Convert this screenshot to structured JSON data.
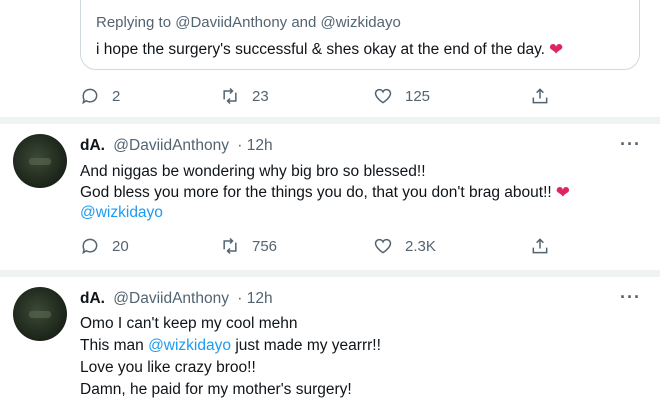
{
  "quoted_reply": {
    "header_partial": "@_ _ _ _ _ _ _ _ _",
    "replying_prefix": "Replying to",
    "replying_to": "@DaviidAnthony",
    "and": "and",
    "replying_to_2": "@wizkidayo",
    "text": "i hope the surgery's successful & shes okay at the end of the day.",
    "emoji": "❤"
  },
  "quoted_actions": {
    "replies": "2",
    "retweets": "23",
    "likes": "125"
  },
  "tweets": [
    {
      "name": "dA.",
      "handle": "@DaviidAnthony",
      "time": "· 12h",
      "lines": [
        "And niggas be wondering why big bro so blessed!!",
        "God bless you more for the things you do, that you don't brag about!!"
      ],
      "emoji": "❤",
      "mention": "@wizkidayo",
      "actions": {
        "replies": "20",
        "retweets": "756",
        "likes": "2.3K"
      }
    },
    {
      "name": "dA.",
      "handle": "@DaviidAnthony",
      "time": "· 12h",
      "line1": "Omo I can't keep my cool mehn",
      "line2_pre": "This man",
      "line2_mention": "@wizkidayo",
      "line2_post": "just made my yearrr!!",
      "line3": "Love you like crazy broo!!",
      "line4": "Damn, he paid for my mother's surgery!"
    }
  ],
  "more_label": "···",
  "icons": [
    "reply-icon",
    "retweet-icon",
    "like-icon",
    "share-icon",
    "more-icon"
  ],
  "colors": {
    "mention": "#1d9bf0",
    "secondary_text": "#536471",
    "heart": "#e0245e",
    "divider": "#eff3f4"
  }
}
